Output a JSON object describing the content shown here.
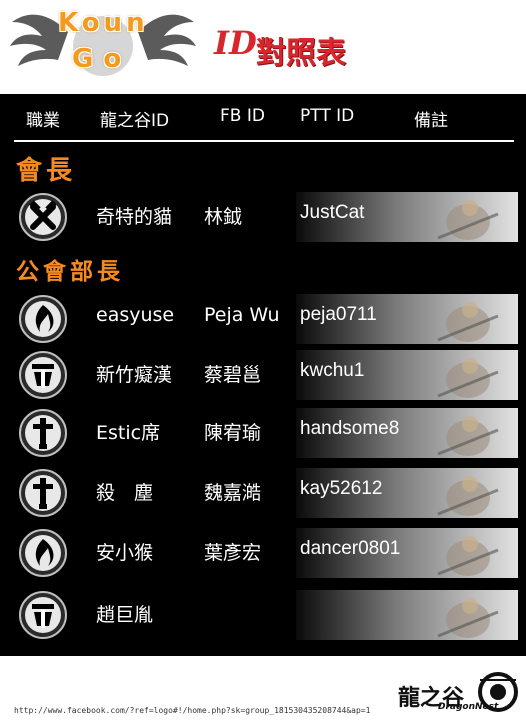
{
  "header": {
    "logo_line1": "Koun",
    "logo_line2": "Go",
    "title_prefix": "ID",
    "title_main": "對照表"
  },
  "columns": [
    "職業",
    "龍之谷ID",
    "FB ID",
    "PTT ID",
    "備註"
  ],
  "sections": {
    "leader": "會長",
    "officers": "公會部長"
  },
  "rows": [
    {
      "emblem": "warrior-hammer-emblem",
      "name": "奇特的貓",
      "fb": "林鉞",
      "ptt": "JustCat"
    },
    {
      "emblem": "mage-flame-emblem",
      "name": "easyuse",
      "fb": "Peja Wu",
      "ptt": "peja0711"
    },
    {
      "emblem": "cleric-crest-emblem",
      "name": "新竹癡漢",
      "fb": "蔡碧邕",
      "ptt": "kwchu1"
    },
    {
      "emblem": "warrior-sword-emblem",
      "name": "Estic席",
      "fb": "陳宥瑜",
      "ptt": "handsome8"
    },
    {
      "emblem": "warrior-sword-emblem",
      "name": "殺　塵",
      "fb": "魏嘉澔",
      "ptt": "kay52612"
    },
    {
      "emblem": "mage-flame-emblem",
      "name": "安小猴",
      "fb": "葉彥宏",
      "ptt": "dancer0801"
    },
    {
      "emblem": "cleric-crest-emblem",
      "name": "趙巨胤",
      "fb": "",
      "ptt": ""
    }
  ],
  "footer": {
    "url": "http://www.facebook.com/?ref=logo#!/home.php?sk=group_181530435208744&ap=1",
    "brand": "龍之谷",
    "brand_sub": "DragonNest"
  },
  "colors": {
    "section": "#f6891f",
    "title": "#d8262e",
    "logo": "#f39a1f"
  }
}
